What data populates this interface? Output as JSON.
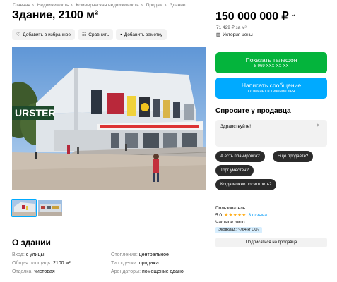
{
  "breadcrumbs": [
    "Главная",
    "Недвижимость",
    "Коммерческая недвижимость",
    "Продам",
    "Здание"
  ],
  "title": "Здание, 2100 м²",
  "actions": {
    "favorite": "Добавить в избранное",
    "compare": "Сравнить",
    "note": "Добавить заметку"
  },
  "price": {
    "amount": "150 000 000 ₽",
    "per_m2": "71 429 ₽ за м²",
    "history": "История цены"
  },
  "contact": {
    "phone_button": "Показать телефон",
    "phone_masked": "8 969 XXX-XX-XX",
    "message_button": "Написать сообщение",
    "message_sub": "Отвечает в течение дня"
  },
  "ask": {
    "title": "Спросите у продавца",
    "input_value": "Здравствуйте!",
    "chips": [
      "А есть планировка?",
      "Ещё продаёте?",
      "Торг уместен?",
      "Когда можно посмотреть?"
    ]
  },
  "seller": {
    "label": "Пользователь",
    "rating": "5.0",
    "stars": "★★★★★",
    "reviews": "3 отзыва",
    "type": "Частное лицо",
    "eco": "Эковклад: ~764 кг CO₂",
    "subscribe": "Подписаться на продавца"
  },
  "photo": {
    "sign_text": "URSTER"
  },
  "about": {
    "title": "О здании",
    "params": [
      {
        "k": "Вход: ",
        "v": "с улицы"
      },
      {
        "k": "Отопление: ",
        "v": "центральное"
      },
      {
        "k": "Общая площадь: ",
        "v": "2100 м²"
      },
      {
        "k": "Тип сделки: ",
        "v": "продажа"
      },
      {
        "k": "Отделка: ",
        "v": "чистовая"
      },
      {
        "k": "Арендаторы: ",
        "v": "помещение сдано"
      }
    ]
  },
  "colors": {
    "green": "#04b43c",
    "blue": "#00aaff",
    "chip": "#2b2b2b"
  }
}
